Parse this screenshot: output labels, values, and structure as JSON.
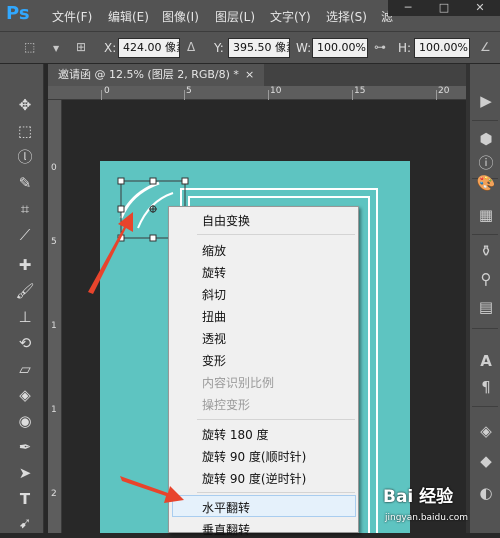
{
  "app": {
    "logo": "Ps"
  },
  "menubar": {
    "items": [
      "文件(F)",
      "编辑(E)",
      "图像(I)",
      "图层(L)",
      "文字(Y)",
      "选择(S)",
      "滤"
    ]
  },
  "window_controls": {
    "minimize": "─",
    "restore": "□",
    "close": "✕"
  },
  "options": {
    "x_label": "X:",
    "x_value": "424.00 像素",
    "y_label": "Y:",
    "y_value": "395.50 像素",
    "w_label": "W:",
    "w_value": "100.00%",
    "h_label": "H:",
    "h_value": "100.00%"
  },
  "document_tab": {
    "title": "邀请函 @ 12.5% (图层 2, RGB/8) *",
    "close": "×"
  },
  "ruler": {
    "top_numbers": [
      "0",
      "5",
      "10",
      "15",
      "20"
    ],
    "left_numbers": [
      "0",
      "5",
      "1",
      "1",
      "2"
    ]
  },
  "tools": {
    "left_icons": [
      "move-icon",
      "marquee-icon",
      "lasso-icon",
      "quick-select-icon",
      "crop-icon",
      "eyedropper-icon",
      "healing-icon",
      "brush-icon",
      "stamp-icon",
      "history-brush-icon",
      "eraser-icon",
      "paint-bucket-icon",
      "dodge-icon",
      "pen-icon",
      "path-select-icon",
      "type-icon",
      "direct-select-icon"
    ],
    "right_icons": [
      "play-icon",
      "cube-icon",
      "palette-icon",
      "styles-icon",
      "brushes-icon",
      "adjust-icon",
      "stack-icon",
      "character-icon",
      "paragraph-icon",
      "3d-icon",
      "layers-icon",
      "channels-icon"
    ]
  },
  "context_menu": {
    "items": [
      {
        "label": "自由变换",
        "enabled": true
      },
      {
        "label": "缩放",
        "enabled": true
      },
      {
        "label": "旋转",
        "enabled": true
      },
      {
        "label": "斜切",
        "enabled": true
      },
      {
        "label": "扭曲",
        "enabled": true
      },
      {
        "label": "透视",
        "enabled": true
      },
      {
        "label": "变形",
        "enabled": true
      },
      {
        "label": "内容识别比例",
        "enabled": false
      },
      {
        "label": "操控变形",
        "enabled": false
      },
      {
        "label": "旋转 180 度",
        "enabled": true
      },
      {
        "label": "旋转 90 度(顺时针)",
        "enabled": true
      },
      {
        "label": "旋转 90 度(逆时针)",
        "enabled": true
      },
      {
        "label": "水平翻转",
        "enabled": true
      },
      {
        "label": "垂直翻转",
        "enabled": true
      }
    ],
    "highlighted": "水平翻转"
  },
  "watermark": {
    "main": "Bai 经验",
    "sub": "jingyan.baidu.com"
  },
  "colors": {
    "ui_dark": "#535353",
    "workspace": "#282828",
    "canvas_teal": "#5ec4c1",
    "annotation_arrow": "#e8442c",
    "menu_highlight": "#e5f1fb"
  }
}
